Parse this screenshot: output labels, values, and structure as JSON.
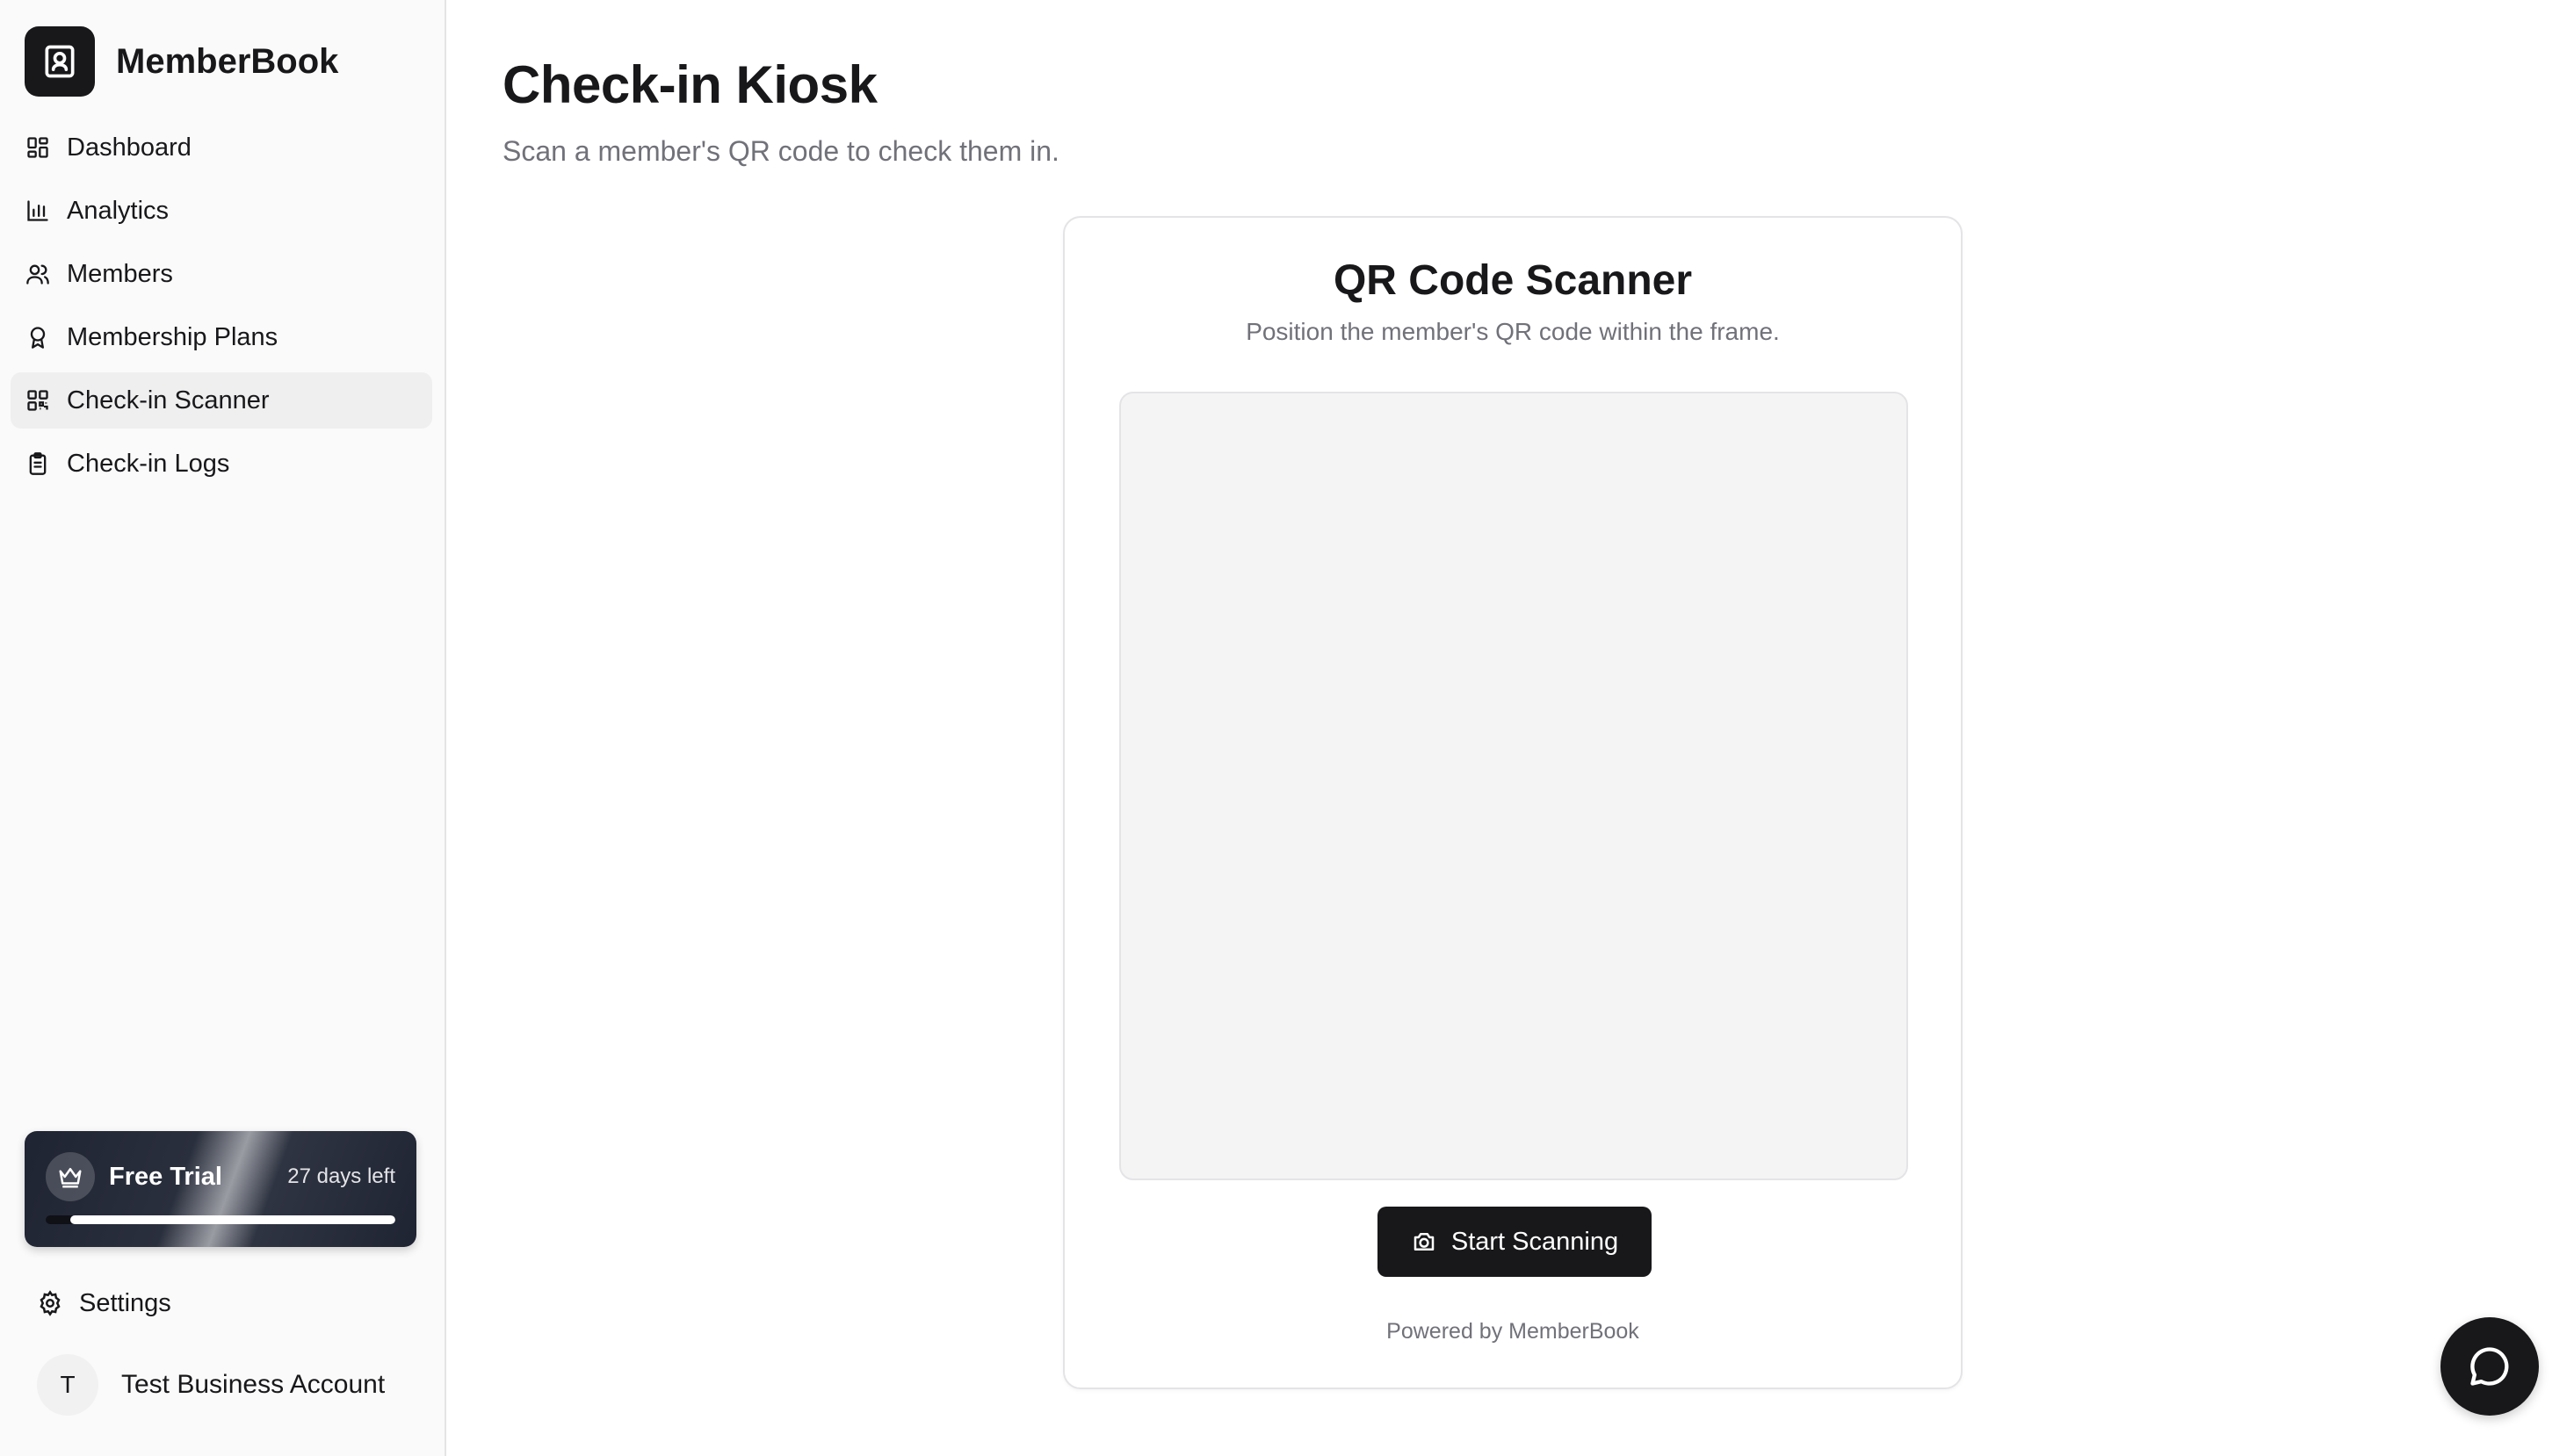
{
  "app": {
    "name": "MemberBook"
  },
  "sidebar": {
    "items": [
      {
        "label": "Dashboard",
        "icon": "dashboard-icon"
      },
      {
        "label": "Analytics",
        "icon": "bar-chart-icon"
      },
      {
        "label": "Members",
        "icon": "users-icon"
      },
      {
        "label": "Membership Plans",
        "icon": "award-icon"
      },
      {
        "label": "Check-in Scanner",
        "icon": "qr-code-icon",
        "active": true
      },
      {
        "label": "Check-in Logs",
        "icon": "clipboard-icon"
      }
    ],
    "trial": {
      "title": "Free Trial",
      "days_left": "27 days left",
      "remaining_fraction": 0.93
    },
    "settings_label": "Settings",
    "account": {
      "initial": "T",
      "name": "Test Business Account"
    }
  },
  "main": {
    "title": "Check-in Kiosk",
    "subtitle": "Scan a member's QR code to check them in.",
    "scanner": {
      "title": "QR Code Scanner",
      "subtitle": "Position the member's QR code within the frame.",
      "button_label": "Start Scanning",
      "powered_by": "Powered by MemberBook"
    }
  },
  "colors": {
    "accent": "#18181b",
    "sidebar_bg": "#fafafa",
    "active_item_bg": "#efeff0",
    "muted_text": "#71717a"
  }
}
